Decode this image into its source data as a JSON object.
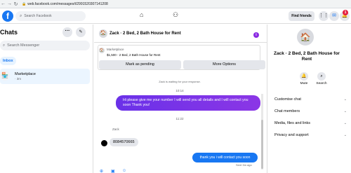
{
  "browser": {
    "url": "web.facebook.com/messages/t/2991520307141208"
  },
  "topnav": {
    "search_placeholder": "Search Facebook",
    "find_friends": "Find friends",
    "notification_count": "1"
  },
  "sidebar": {
    "title": "Chats",
    "search_placeholder": "Search Messenger",
    "inbox_label": "Inbox",
    "threads": [
      {
        "name": "Marketplace",
        "time": "· 3m"
      }
    ]
  },
  "conversation": {
    "title": "Zack · 2 Bed, 2 Bath House for Rent",
    "listing": {
      "source": "Marketplace",
      "description": "$1,500 - 2 Bed, 2 Bath House for Rent",
      "pending_button": "Mark as pending",
      "more_button": "More Options"
    },
    "waiting_text": "Zack is waiting for your response.",
    "timestamp1": "10:14",
    "outgoing1": "Hi please give me your number I will send you all details and I will contact you soon Thank you!",
    "timestamp2": "11:22",
    "sender_name": "Zack",
    "incoming1": "8084570665",
    "outgoing2": "thank you i will contact you soon",
    "sent_status": "Sent 3m ago"
  },
  "details": {
    "title": "Zack · 2 Bed, 2 Bath House for Rent",
    "mute_label": "Mute",
    "search_label": "Search",
    "menu": [
      "Customise chat",
      "Chat members",
      "Media, files and links",
      "Privacy and support"
    ]
  },
  "colors": {
    "accent": "#1877f2",
    "outgoing_gradient": "#7b34e7",
    "badge": "#e41e3f"
  }
}
